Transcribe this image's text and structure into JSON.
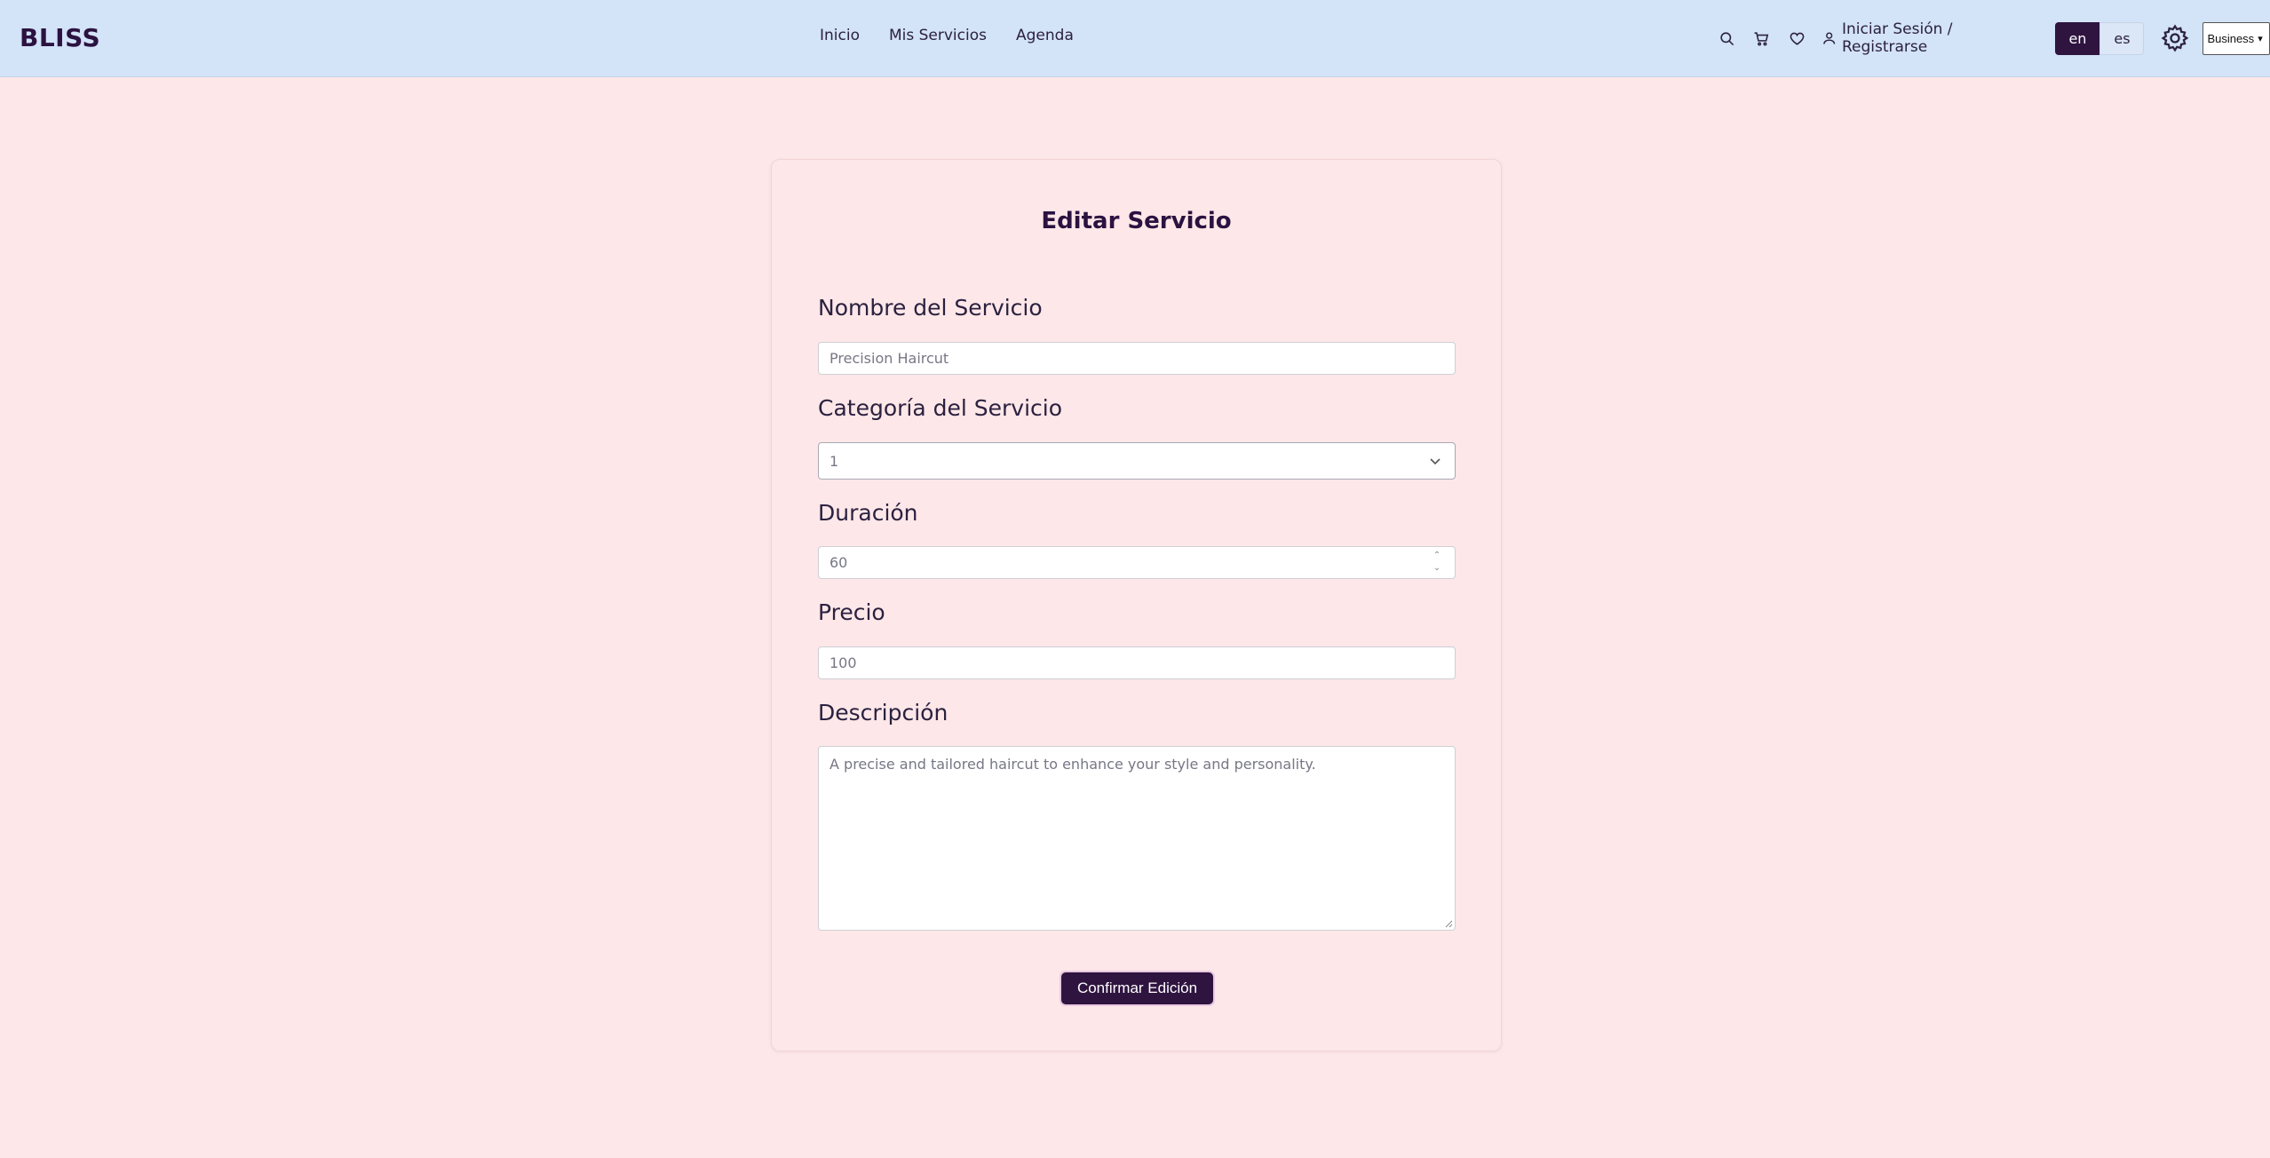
{
  "nav": {
    "logo": "BLISS",
    "links": [
      "Inicio",
      "Mis Servicios",
      "Agenda"
    ],
    "login_label": "Iniciar Sesión / Registrarse",
    "languages": [
      "en",
      "es"
    ],
    "active_language": "en",
    "account_type": "Business"
  },
  "form": {
    "title": "Editar Servicio",
    "name_label": "Nombre del Servicio",
    "name_value": "Precision Haircut",
    "category_label": "Categoría del Servicio",
    "category_value": "1",
    "duration_label": "Duración",
    "duration_value": "60",
    "price_label": "Precio",
    "price_value": "100",
    "description_label": "Descripción",
    "description_value": "A precise and tailored haircut to enhance your style and personality.",
    "submit_label": "Confirmar Edición"
  },
  "colors": {
    "navbar_bg": "#d3e3f8",
    "page_bg": "#fde7e8",
    "primary": "#2f1440"
  },
  "icons": [
    "search-icon",
    "cart-icon",
    "heart-icon",
    "user-icon",
    "gear-icon",
    "chevron-down-icon"
  ]
}
